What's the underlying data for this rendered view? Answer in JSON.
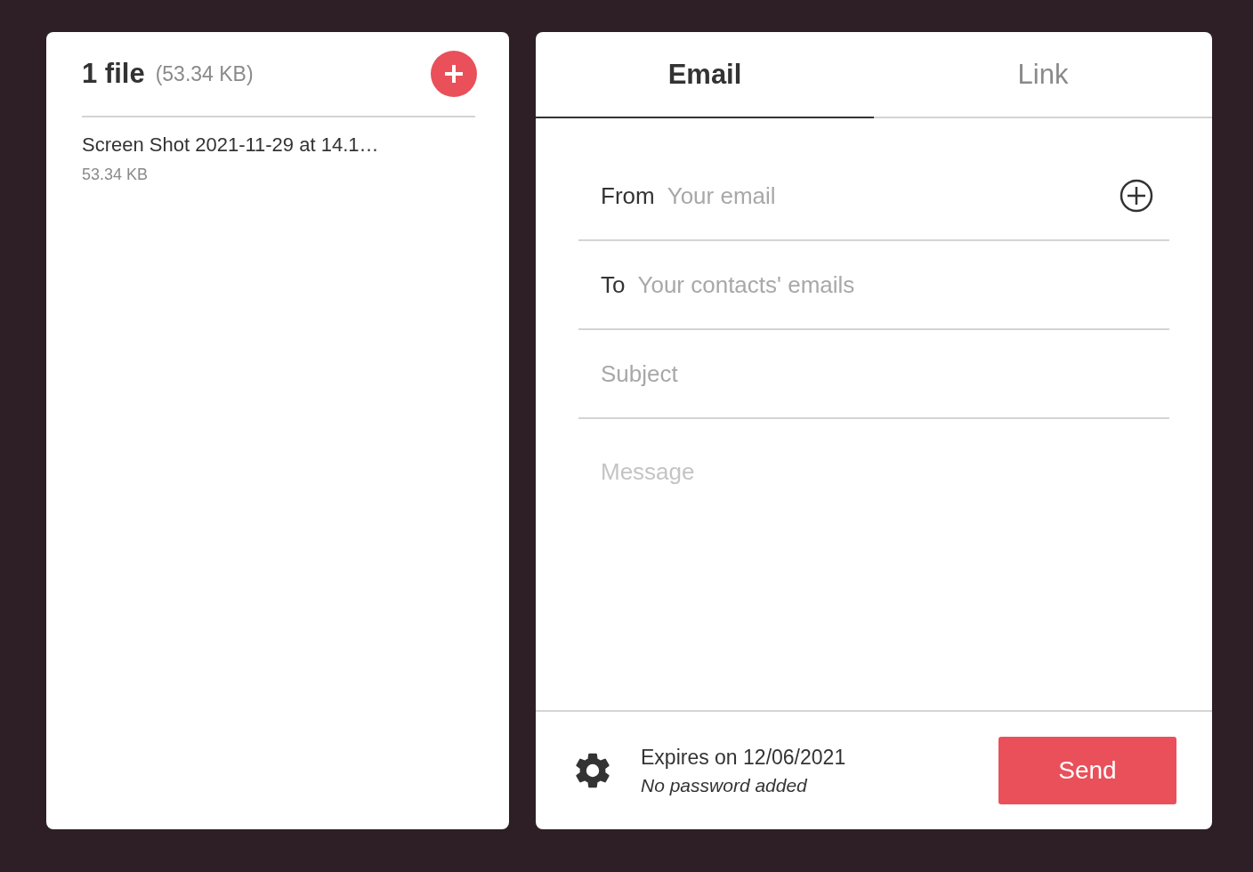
{
  "files_panel": {
    "title": "1 file",
    "total_size": "(53.34 KB)",
    "files": [
      {
        "name": "Screen Shot 2021-11-29 at 14.1…",
        "size": "53.34 KB"
      }
    ]
  },
  "tabs": [
    {
      "label": "Email",
      "selected": true
    },
    {
      "label": "Link",
      "selected": false
    }
  ],
  "form": {
    "fields": [
      {
        "kind": "input",
        "label": "From",
        "placeholder": "Your email",
        "has_add": true
      },
      {
        "kind": "input",
        "label": "To",
        "placeholder": "Your contacts' emails",
        "has_add": false
      },
      {
        "kind": "input",
        "placeholder": "Subject",
        "has_add": false
      },
      {
        "kind": "textarea",
        "placeholder": "Message"
      }
    ]
  },
  "footer": {
    "expires": "Expires on 12/06/2021",
    "password": "No password added",
    "send": "Send"
  }
}
